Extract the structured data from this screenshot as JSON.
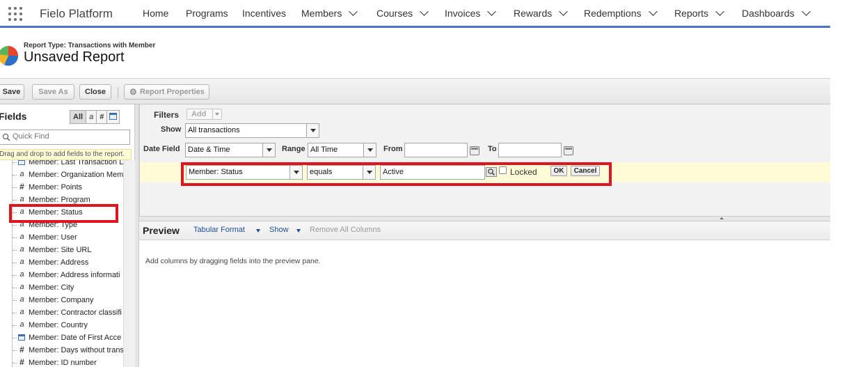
{
  "nav": {
    "app_name": "Fielo Platform",
    "items": [
      {
        "label": "Home",
        "has_menu": false
      },
      {
        "label": "Programs",
        "has_menu": false
      },
      {
        "label": "Incentives",
        "has_menu": false
      },
      {
        "label": "Members",
        "has_menu": true
      },
      {
        "label": "Courses",
        "has_menu": true
      },
      {
        "label": "Invoices",
        "has_menu": true
      },
      {
        "label": "Rewards",
        "has_menu": true
      },
      {
        "label": "Redemptions",
        "has_menu": true
      },
      {
        "label": "Reports",
        "has_menu": true
      },
      {
        "label": "Dashboards",
        "has_menu": true
      }
    ]
  },
  "report": {
    "type_label": "Report Type: Transactions with Member",
    "title": "Unsaved Report"
  },
  "toolbar": {
    "save": "Save",
    "save_as": "Save As",
    "close": "Close",
    "report_properties": "Report Properties"
  },
  "fields": {
    "title": "Fields",
    "filters": [
      "All",
      "a",
      "#"
    ],
    "quick_find_placeholder": "Quick Find",
    "drag_hint": "Drag and drop to add fields to the report.",
    "items": [
      {
        "label": "Member: Last Transaction D",
        "icon": "calendar-icon"
      },
      {
        "label": "Member: Organization Mem",
        "icon": "text-icon"
      },
      {
        "label": "Member: Points",
        "icon": "number-icon"
      },
      {
        "label": "Member: Program",
        "icon": "text-icon"
      },
      {
        "label": "Member: Status",
        "icon": "text-icon"
      },
      {
        "label": "Member: Type",
        "icon": "text-icon"
      },
      {
        "label": "Member: User",
        "icon": "text-icon"
      },
      {
        "label": "Member: Site URL",
        "icon": "text-icon"
      },
      {
        "label": "Member: Address",
        "icon": "text-icon"
      },
      {
        "label": "Member: Address informati",
        "icon": "text-icon"
      },
      {
        "label": "Member: City",
        "icon": "text-icon"
      },
      {
        "label": "Member: Company",
        "icon": "text-icon"
      },
      {
        "label": "Member: Contractor classifi",
        "icon": "text-icon"
      },
      {
        "label": "Member: Country",
        "icon": "text-icon"
      },
      {
        "label": "Member: Date of First Acce",
        "icon": "calendar-icon"
      },
      {
        "label": "Member: Days without trans",
        "icon": "number-icon"
      },
      {
        "label": "Member: ID number",
        "icon": "number-icon"
      }
    ]
  },
  "filters": {
    "title": "Filters",
    "add": "Add",
    "show_label": "Show",
    "show_value": "All transactions",
    "date_field_label": "Date Field",
    "date_field_value": "Date & Time",
    "range_label": "Range",
    "range_value": "All Time",
    "from_label": "From",
    "to_label": "To",
    "filter_row": {
      "field": "Member: Status",
      "operator": "equals",
      "value": "Active",
      "locked_label": "Locked",
      "ok": "OK",
      "cancel": "Cancel"
    }
  },
  "preview": {
    "title": "Preview",
    "format": "Tabular Format",
    "show": "Show",
    "remove_all": "Remove All Columns",
    "hint": "Add columns by dragging fields into the preview pane."
  },
  "colors": {
    "highlight": "#e0141f",
    "nav_underline": "#4a75c4",
    "link": "#1c4e9b"
  }
}
